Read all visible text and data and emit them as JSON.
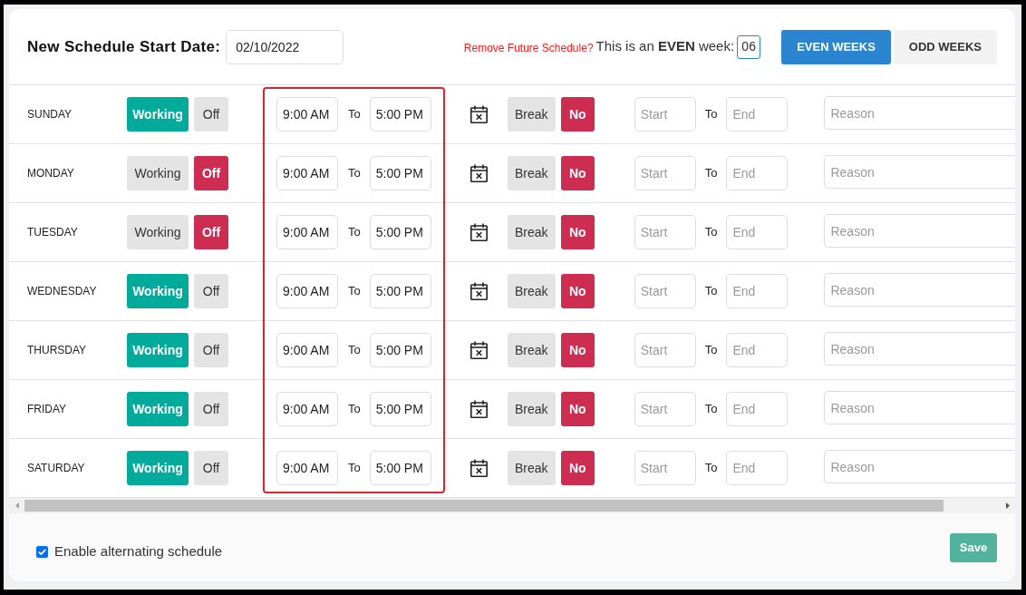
{
  "header": {
    "title": "New Schedule Start Date:",
    "start_date": "02/10/2022",
    "remove_link": "Remove Future Schedule?",
    "week_note": "This is an **EVEN** week:",
    "week_number": "06"
  },
  "week_tabs": [
    {
      "label": "EVEN WEEKS",
      "selected": true
    },
    {
      "label": "ODD WEEKS",
      "selected": false
    }
  ],
  "days": [
    {
      "day": "SUNDAY",
      "status": [
        {
          "label": "Working",
          "selected": true
        },
        {
          "label": "Off",
          "selected": false
        }
      ],
      "start": "9:00 AM",
      "to": "To",
      "end": "5:00 PM",
      "break": [
        {
          "label": "Break",
          "selected": false
        },
        {
          "label": "No",
          "selected": true
        }
      ],
      "break_start": {
        "placeholder": "Start"
      },
      "break_to": "To",
      "break_end": {
        "placeholder": "End"
      },
      "reason": {
        "placeholder": "Reason"
      }
    },
    {
      "day": "MONDAY",
      "status": [
        {
          "label": "Working",
          "selected": false
        },
        {
          "label": "Off",
          "selected": true
        }
      ],
      "start": "9:00 AM",
      "to": "To",
      "end": "5:00 PM",
      "break": [
        {
          "label": "Break",
          "selected": false
        },
        {
          "label": "No",
          "selected": true
        }
      ],
      "break_start": {
        "placeholder": "Start"
      },
      "break_to": "To",
      "break_end": {
        "placeholder": "End"
      },
      "reason": {
        "placeholder": "Reason"
      }
    },
    {
      "day": "TUESDAY",
      "status": [
        {
          "label": "Working",
          "selected": false
        },
        {
          "label": "Off",
          "selected": true
        }
      ],
      "start": "9:00 AM",
      "to": "To",
      "end": "5:00 PM",
      "break": [
        {
          "label": "Break",
          "selected": false
        },
        {
          "label": "No",
          "selected": true
        }
      ],
      "break_start": {
        "placeholder": "Start"
      },
      "break_to": "To",
      "break_end": {
        "placeholder": "End"
      },
      "reason": {
        "placeholder": "Reason"
      }
    },
    {
      "day": "WEDNESDAY",
      "status": [
        {
          "label": "Working",
          "selected": true
        },
        {
          "label": "Off",
          "selected": false
        }
      ],
      "start": "9:00 AM",
      "to": "To",
      "end": "5:00 PM",
      "break": [
        {
          "label": "Break",
          "selected": false
        },
        {
          "label": "No",
          "selected": true
        }
      ],
      "break_start": {
        "placeholder": "Start"
      },
      "break_to": "To",
      "break_end": {
        "placeholder": "End"
      },
      "reason": {
        "placeholder": "Reason"
      }
    },
    {
      "day": "THURSDAY",
      "status": [
        {
          "label": "Working",
          "selected": true
        },
        {
          "label": "Off",
          "selected": false
        }
      ],
      "start": "9:00 AM",
      "to": "To",
      "end": "5:00 PM",
      "break": [
        {
          "label": "Break",
          "selected": false
        },
        {
          "label": "No",
          "selected": true
        }
      ],
      "break_start": {
        "placeholder": "Start"
      },
      "break_to": "To",
      "break_end": {
        "placeholder": "End"
      },
      "reason": {
        "placeholder": "Reason"
      }
    },
    {
      "day": "FRIDAY",
      "status": [
        {
          "label": "Working",
          "selected": true
        },
        {
          "label": "Off",
          "selected": false
        }
      ],
      "start": "9:00 AM",
      "to": "To",
      "end": "5:00 PM",
      "break": [
        {
          "label": "Break",
          "selected": false
        },
        {
          "label": "No",
          "selected": true
        }
      ],
      "break_start": {
        "placeholder": "Start"
      },
      "break_to": "To",
      "break_end": {
        "placeholder": "End"
      },
      "reason": {
        "placeholder": "Reason"
      }
    },
    {
      "day": "SATURDAY",
      "status": [
        {
          "label": "Working",
          "selected": true
        },
        {
          "label": "Off",
          "selected": false
        }
      ],
      "start": "9:00 AM",
      "to": "To",
      "end": "5:00 PM",
      "break": [
        {
          "label": "Break",
          "selected": false
        },
        {
          "label": "No",
          "selected": true
        }
      ],
      "break_start": {
        "placeholder": "Start"
      },
      "break_to": "To",
      "break_end": {
        "placeholder": "End"
      },
      "reason": {
        "placeholder": "Reason"
      }
    }
  ],
  "footer": {
    "alternating": {
      "label": "Enable alternating schedule",
      "checked": true
    },
    "save": "Save"
  }
}
